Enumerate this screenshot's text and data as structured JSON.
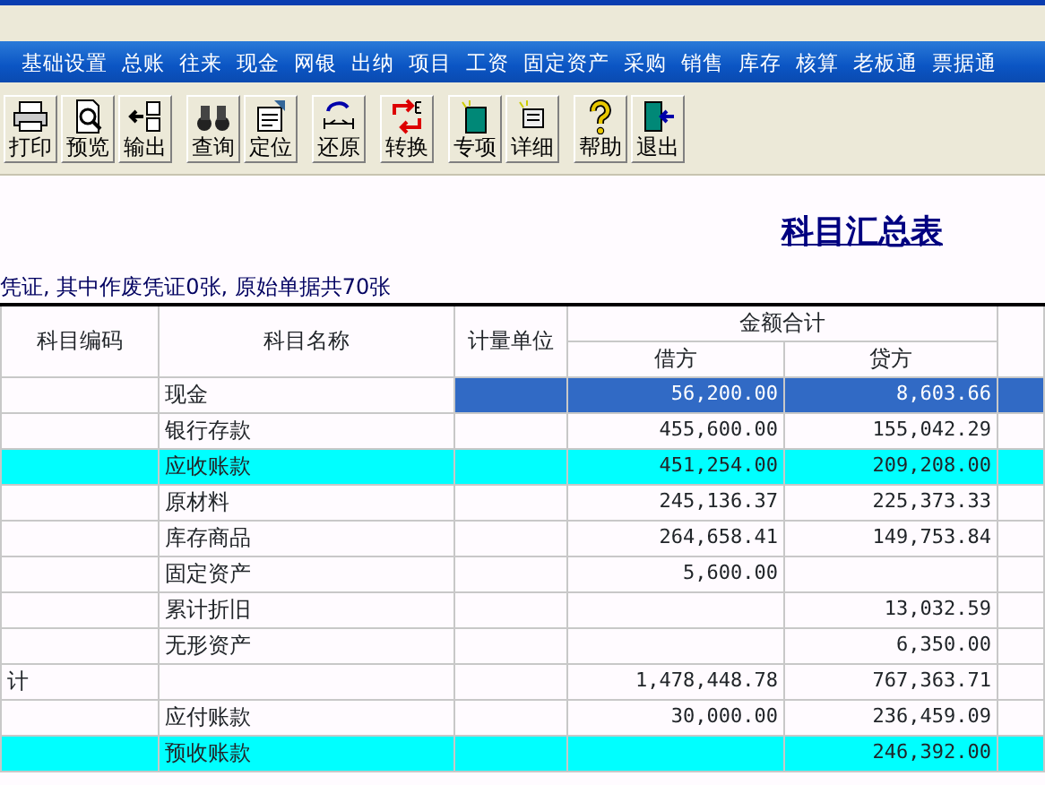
{
  "menu": [
    "基础设置",
    "总账",
    "往来",
    "现金",
    "网银",
    "出纳",
    "项目",
    "工资",
    "固定资产",
    "采购",
    "销售",
    "库存",
    "核算",
    "老板通",
    "票据通"
  ],
  "toolbar": [
    {
      "buttons": [
        {
          "label": "打印"
        },
        {
          "label": "预览"
        },
        {
          "label": "输出"
        }
      ]
    },
    {
      "buttons": [
        {
          "label": "查询"
        },
        {
          "label": "定位"
        }
      ]
    },
    {
      "buttons": [
        {
          "label": "还原"
        }
      ]
    },
    {
      "buttons": [
        {
          "label": "转换"
        }
      ]
    },
    {
      "buttons": [
        {
          "label": "专项"
        },
        {
          "label": "详细"
        }
      ]
    },
    {
      "buttons": [
        {
          "label": "帮助"
        },
        {
          "label": "退出"
        }
      ]
    }
  ],
  "report": {
    "title": "科目汇总表",
    "subtitle": "凭证, 其中作废凭证0张, 原始单据共70张"
  },
  "table": {
    "columns": [
      "科目编码",
      "科目名称",
      "计量单位"
    ],
    "group_header": "金额合计",
    "sub_columns": [
      "借方",
      "贷方"
    ],
    "rows": [
      {
        "code": "",
        "name": "现金",
        "debit": "56,200.00",
        "credit": "8,603.66",
        "selected": true,
        "highlighted": false
      },
      {
        "code": "",
        "name": "银行存款",
        "debit": "455,600.00",
        "credit": "155,042.29",
        "selected": false,
        "highlighted": false
      },
      {
        "code": "",
        "name": "应收账款",
        "debit": "451,254.00",
        "credit": "209,208.00",
        "selected": false,
        "highlighted": true
      },
      {
        "code": "",
        "name": "原材料",
        "debit": "245,136.37",
        "credit": "225,373.33",
        "selected": false,
        "highlighted": false
      },
      {
        "code": "",
        "name": "库存商品",
        "debit": "264,658.41",
        "credit": "149,753.84",
        "selected": false,
        "highlighted": false
      },
      {
        "code": "",
        "name": "固定资产",
        "debit": "5,600.00",
        "credit": "",
        "selected": false,
        "highlighted": false
      },
      {
        "code": "",
        "name": "累计折旧",
        "debit": "",
        "credit": "13,032.59",
        "selected": false,
        "highlighted": false
      },
      {
        "code": "",
        "name": "无形资产",
        "debit": "",
        "credit": "6,350.00",
        "selected": false,
        "highlighted": false
      },
      {
        "code": "计",
        "name": "",
        "debit": "1,478,448.78",
        "credit": "767,363.71",
        "selected": false,
        "highlighted": false
      },
      {
        "code": "",
        "name": "应付账款",
        "debit": "30,000.00",
        "credit": "236,459.09",
        "selected": false,
        "highlighted": false
      },
      {
        "code": "",
        "name": "预收账款",
        "debit": "",
        "credit": "246,392.00",
        "selected": false,
        "highlighted": true
      }
    ]
  }
}
